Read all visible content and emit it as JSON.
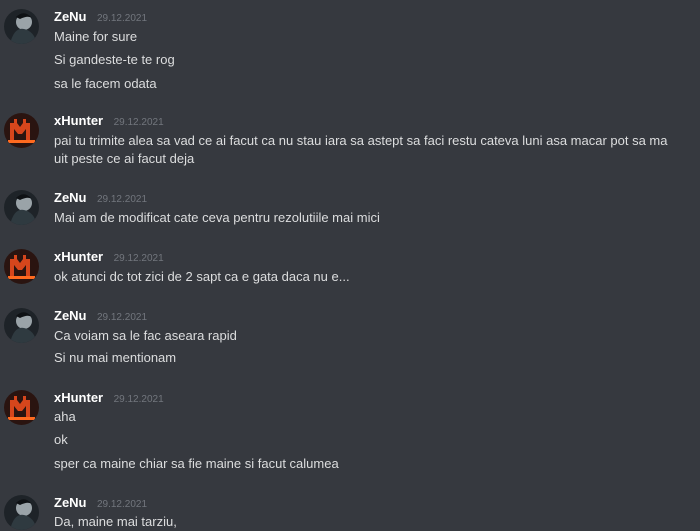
{
  "colors": {
    "background": "#36393f",
    "username": "#ffffff",
    "timestamp": "#72767d",
    "message_text": "#dcddde"
  },
  "messages": [
    {
      "username": "ZeNu",
      "timestamp": "29.12.2021",
      "avatar_icon": "dark-portrait-avatar",
      "lines": [
        "Maine for sure",
        "Si gandeste-te te rog",
        "sa le facem odata"
      ]
    },
    {
      "username": "xHunter",
      "timestamp": "29.12.2021",
      "avatar_icon": "red-m-logo-avatar",
      "lines": [
        "pai tu trimite alea sa vad ce ai facut ca nu stau iara sa astept sa faci restu cateva luni asa macar pot sa ma uit peste ce ai facut deja"
      ]
    },
    {
      "username": "ZeNu",
      "timestamp": "29.12.2021",
      "avatar_icon": "dark-portrait-avatar",
      "lines": [
        "Mai am de modificat cate ceva pentru rezolutiile mai mici"
      ]
    },
    {
      "username": "xHunter",
      "timestamp": "29.12.2021",
      "avatar_icon": "red-m-logo-avatar",
      "lines": [
        "ok atunci dc tot zici de 2 sapt ca e gata daca nu e..."
      ]
    },
    {
      "username": "ZeNu",
      "timestamp": "29.12.2021",
      "avatar_icon": "dark-portrait-avatar",
      "lines": [
        "Ca voiam sa le fac aseara rapid",
        "Si nu mai mentionam"
      ]
    },
    {
      "username": "xHunter",
      "timestamp": "29.12.2021",
      "avatar_icon": "red-m-logo-avatar",
      "lines": [
        "aha",
        "ok",
        "sper ca maine chiar sa fie maine si facut calumea"
      ]
    },
    {
      "username": "ZeNu",
      "timestamp": "29.12.2021",
      "avatar_icon": "dark-portrait-avatar",
      "lines": [
        "Da, maine mai tarziu,"
      ]
    }
  ]
}
